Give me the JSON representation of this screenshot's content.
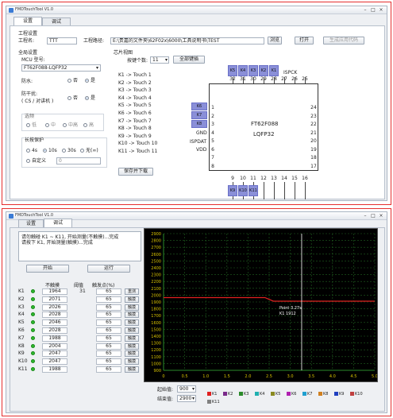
{
  "top": {
    "title": "FMDTouchTool V1.0",
    "tabs": [
      "设置",
      "调试"
    ],
    "project_label": "工程设置",
    "name_label": "工程名:",
    "name_value": "TTT",
    "path_label": "工程路径:",
    "path_value": "E:\\贵嘉的文件夹\\62F02x\\6000\\工具说明书\\TEST",
    "browse_btn": "浏览",
    "open_btn": "打开",
    "gen_btn": "生成应用代码",
    "global_label": "全局设置",
    "mcu_label": "MCU 型号:",
    "mcu_value": "FT62F088-LQFP32",
    "waterproof_label": "防水:",
    "opt_no": "否",
    "opt_yes": "是",
    "cs_label_1": "防干扰:",
    "cs_label_2": "( CS / 对讲机 )",
    "sens_label": "选频",
    "sens_opts": [
      "低",
      "中",
      "中高",
      "高"
    ],
    "longpress_label": "长按保护",
    "lp_opts": [
      "4s",
      "10s",
      "30s",
      "无(∞)"
    ],
    "custom_label": "自定义",
    "custom_value": "0",
    "chip_view_label": "芯片视图",
    "key_count_label": "按键个数:",
    "key_count_value": "11",
    "select_all_btn": "全部键插",
    "touch_list": [
      "K1 -> Touch 1",
      "K2 -> Touch 2",
      "K3 -> Touch 3",
      "K4 -> Touch 4",
      "K5 -> Touch 5",
      "K6 -> Touch 6",
      "K7 -> Touch 7",
      "K8 -> Touch 8",
      "K9 -> Touch 9",
      "K10 -> Touch 10",
      "K11 -> Touch 11"
    ],
    "save_btn": "保存并下载",
    "chip_name": "FT62F088",
    "chip_pkg": "LQFP32",
    "ispck": "ISPCK",
    "gnd": "GND",
    "ispdat": "ISPDAT",
    "vdd": "VDD",
    "top_keys": [
      "K5",
      "K4",
      "K3",
      "K2",
      "K1"
    ],
    "top_pins": [
      "32",
      "31",
      "30",
      "29",
      "28",
      "27",
      "26",
      "25"
    ],
    "left_keys": [
      "K6",
      "K7",
      "K8"
    ],
    "left_pins": [
      "1",
      "2",
      "3",
      "4",
      "5",
      "6",
      "7",
      "8"
    ],
    "right_pins": [
      "24",
      "23",
      "22",
      "21",
      "20",
      "19",
      "18",
      "17"
    ],
    "bottom_pins": [
      "9",
      "10",
      "11",
      "12",
      "13",
      "14",
      "15",
      "16"
    ],
    "bottom_keys": [
      "K9",
      "K10",
      "K11"
    ],
    "key_color": "#8a8fd8"
  },
  "bottom": {
    "title": "FMDTouchTool V1.0",
    "tabs": [
      "设置",
      "调试"
    ],
    "log_lines": [
      "请勿触碰 K1 ~ K11, 开始测量(不触摸)...完成",
      "请按下 K1, 开始测量(触摸)...完成"
    ],
    "start_btn": "开始",
    "run_btn": "运行",
    "col_headers": [
      "不触摸",
      "阈值",
      "触发点(%)"
    ],
    "rows": [
      {
        "key": "K1",
        "untouched": "1964",
        "threshold": "31",
        "pct": "65",
        "btn": "重测"
      },
      {
        "key": "K2",
        "untouched": "2071",
        "threshold": "",
        "pct": "65",
        "btn": "触摸"
      },
      {
        "key": "K3",
        "untouched": "2026",
        "threshold": "",
        "pct": "65",
        "btn": "触摸"
      },
      {
        "key": "K4",
        "untouched": "2028",
        "threshold": "",
        "pct": "65",
        "btn": "触摸"
      },
      {
        "key": "K5",
        "untouched": "2046",
        "threshold": "",
        "pct": "65",
        "btn": "触摸"
      },
      {
        "key": "K6",
        "untouched": "2028",
        "threshold": "",
        "pct": "65",
        "btn": "触摸"
      },
      {
        "key": "K7",
        "untouched": "1988",
        "threshold": "",
        "pct": "65",
        "btn": "触摸"
      },
      {
        "key": "K8",
        "untouched": "2004",
        "threshold": "",
        "pct": "65",
        "btn": "触摸"
      },
      {
        "key": "K9",
        "untouched": "2047",
        "threshold": "",
        "pct": "65",
        "btn": "触摸"
      },
      {
        "key": "K10",
        "untouched": "2047",
        "threshold": "",
        "pct": "65",
        "btn": "触摸"
      },
      {
        "key": "K11",
        "untouched": "1988",
        "threshold": "",
        "pct": "65",
        "btn": "触摸"
      }
    ],
    "start_val_label": "起始值:",
    "start_val": "900",
    "end_val_label": "结束值:",
    "end_val": "2900",
    "tooltip_l1": "Point    3.27s",
    "tooltip_l2": "K1       1912",
    "legend": [
      "K1",
      "K2",
      "K3",
      "K4",
      "K5",
      "K6",
      "K7",
      "K8",
      "K9",
      "K10",
      "K11"
    ],
    "legend_colors": [
      "#e02020",
      "#7a2a8a",
      "#2a8a2a",
      "#20b0b0",
      "#8a8a20",
      "#b020b0",
      "#20a0d0",
      "#d08020",
      "#2040c0",
      "#c04040",
      "#808080"
    ]
  },
  "chart_data": {
    "type": "line",
    "title": "",
    "xlabel": "",
    "ylabel": "",
    "xlim": [
      0,
      5.0
    ],
    "ylim": [
      900,
      2900
    ],
    "x_ticks": [
      "0",
      "0.5",
      "1.0",
      "1.5",
      "2.0",
      "2.5",
      "3.0",
      "3.5",
      "4.0",
      "4.5",
      "5.0"
    ],
    "y_ticks": [
      "900",
      "1000",
      "1100",
      "1200",
      "1300",
      "1400",
      "1500",
      "1600",
      "1700",
      "1800",
      "1900",
      "2000",
      "2100",
      "2200",
      "2300",
      "2400",
      "2500",
      "2600",
      "2700",
      "2800",
      "2900"
    ],
    "grid": true,
    "cursor_x": 3.27,
    "series": [
      {
        "name": "K1",
        "color": "#e02020",
        "x": [
          0,
          2.4,
          2.6,
          3.0,
          3.27,
          4.0,
          5.0
        ],
        "values": [
          1964,
          1964,
          1912,
          1912,
          1912,
          1912,
          1912
        ]
      }
    ]
  }
}
